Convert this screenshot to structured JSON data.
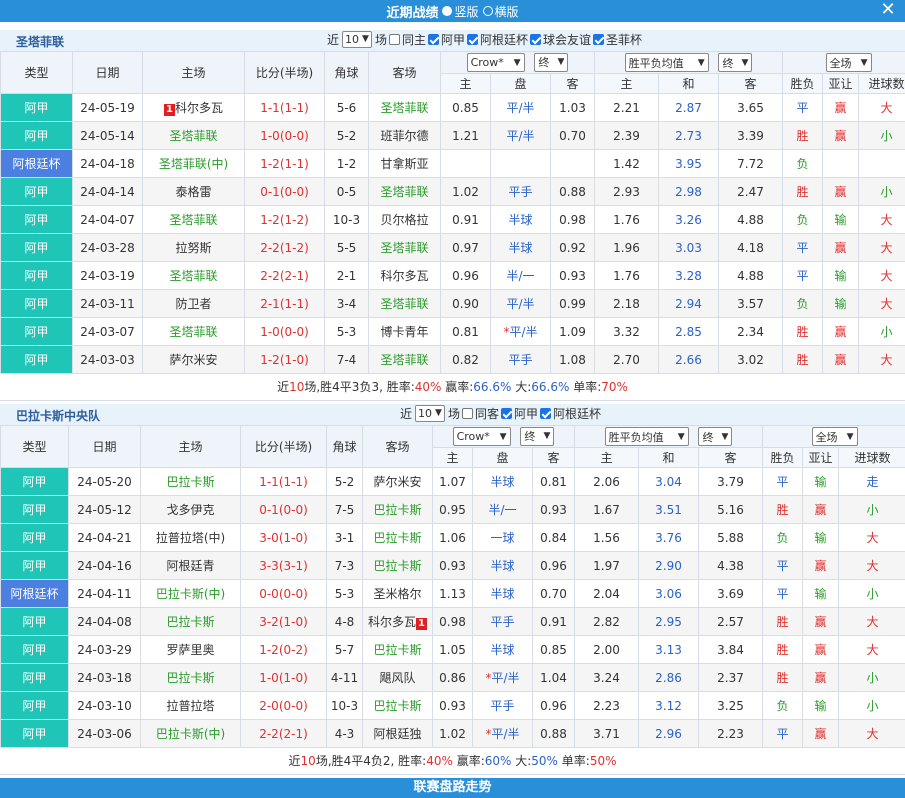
{
  "header": {
    "title": "近期战绩",
    "opt1": "竖版",
    "opt2": "横版"
  },
  "footer": {
    "title": "联赛盘路走势"
  },
  "columns": {
    "type": "类型",
    "date": "日期",
    "home": "主场",
    "score": "比分(半场)",
    "corner": "角球",
    "away": "客场",
    "win": "胜负",
    "handicap": "亚让",
    "goals": "进球数",
    "h": "主",
    "pan": "盘",
    "a": "客",
    "he": "和"
  },
  "odds_selects": {
    "company": "Crow*",
    "stage1": "终",
    "stage2": "终",
    "avg": "胜平负均值",
    "scope": "全场"
  },
  "s1": {
    "title": "圣塔菲联",
    "f": {
      "near": "近",
      "count": "10",
      "unit": "场",
      "same": "同主",
      "c1": "阿甲",
      "c2": "阿根廷杯",
      "c3": "球会友谊",
      "c4": "圣菲杯"
    },
    "rows": [
      {
        "t": "阿甲",
        "d": "24-05-19",
        "h": "科尔多瓦",
        "hrc": "1",
        "sc": "1-1(1-1)",
        "scc": "red",
        "cn": "5-6",
        "a": "圣塔菲联",
        "h1": "0.85",
        "pan": "平/半",
        "a1": "1.03",
        "w": "2.21",
        "dr": "2.87",
        "l": "3.65",
        "r": "平",
        "rc": "blue",
        "hc": "赢",
        "hcc": "red",
        "g": "大",
        "gc": "red"
      },
      {
        "t": "阿甲",
        "d": "24-05-14",
        "h": "圣塔菲联",
        "sc": "1-0(0-0)",
        "scc": "red",
        "cn": "5-2",
        "a": "班菲尔德",
        "h1": "1.21",
        "pan": "平/半",
        "a1": "0.70",
        "w": "2.39",
        "dr": "2.73",
        "l": "3.39",
        "r": "胜",
        "rc": "red",
        "hc": "赢",
        "hcc": "red",
        "g": "小",
        "gc": "green"
      },
      {
        "t": "阿根廷杯",
        "cup": true,
        "d": "24-04-18",
        "h": "圣塔菲联(中)",
        "sc": "1-2(1-1)",
        "scc": "red",
        "cn": "1-2",
        "a": "甘拿斯亚",
        "h1": "",
        "pan": "",
        "a1": "",
        "w": "1.42",
        "dr": "3.95",
        "l": "7.72",
        "r": "负",
        "rc": "green",
        "hc": "",
        "hcc": "",
        "g": "",
        "gc": ""
      },
      {
        "t": "阿甲",
        "d": "24-04-14",
        "h": "泰格雷",
        "sc": "0-1(0-0)",
        "scc": "red",
        "cn": "0-5",
        "a": "圣塔菲联",
        "h1": "1.02",
        "pan": "平手",
        "a1": "0.88",
        "w": "2.93",
        "dr": "2.98",
        "l": "2.47",
        "r": "胜",
        "rc": "red",
        "hc": "赢",
        "hcc": "red",
        "g": "小",
        "gc": "green"
      },
      {
        "t": "阿甲",
        "d": "24-04-07",
        "h": "圣塔菲联",
        "sc": "1-2(1-2)",
        "scc": "red",
        "cn": "10-3",
        "a": "贝尔格拉",
        "h1": "0.91",
        "pan": "半球",
        "a1": "0.98",
        "w": "1.76",
        "dr": "3.26",
        "l": "4.88",
        "r": "负",
        "rc": "green",
        "hc": "输",
        "hcc": "green",
        "g": "大",
        "gc": "red"
      },
      {
        "t": "阿甲",
        "d": "24-03-28",
        "h": "拉努斯",
        "sc": "2-2(1-2)",
        "scc": "red",
        "cn": "5-5",
        "a": "圣塔菲联",
        "h1": "0.97",
        "pan": "半球",
        "a1": "0.92",
        "w": "1.96",
        "dr": "3.03",
        "l": "4.18",
        "r": "平",
        "rc": "blue",
        "hc": "赢",
        "hcc": "red",
        "g": "大",
        "gc": "red"
      },
      {
        "t": "阿甲",
        "d": "24-03-19",
        "h": "圣塔菲联",
        "sc": "2-2(2-1)",
        "scc": "red",
        "cn": "2-1",
        "a": "科尔多瓦",
        "h1": "0.96",
        "pan": "半/一",
        "a1": "0.93",
        "w": "1.76",
        "dr": "3.28",
        "l": "4.88",
        "r": "平",
        "rc": "blue",
        "hc": "输",
        "hcc": "green",
        "g": "大",
        "gc": "red"
      },
      {
        "t": "阿甲",
        "d": "24-03-11",
        "h": "防卫者",
        "sc": "2-1(1-1)",
        "scc": "red",
        "cn": "3-4",
        "a": "圣塔菲联",
        "h1": "0.90",
        "pan": "平/半",
        "a1": "0.99",
        "w": "2.18",
        "dr": "2.94",
        "l": "3.57",
        "r": "负",
        "rc": "green",
        "hc": "输",
        "hcc": "green",
        "g": "大",
        "gc": "red"
      },
      {
        "t": "阿甲",
        "d": "24-03-07",
        "h": "圣塔菲联",
        "sc": "1-0(0-0)",
        "scc": "red",
        "cn": "5-3",
        "a": "博卡青年",
        "h1": "0.81",
        "pan": "*平/半",
        "panstar": true,
        "a1": "1.09",
        "w": "3.32",
        "dr": "2.85",
        "l": "2.34",
        "r": "胜",
        "rc": "red",
        "hc": "赢",
        "hcc": "red",
        "g": "小",
        "gc": "green"
      },
      {
        "t": "阿甲",
        "d": "24-03-03",
        "h": "萨尔米安",
        "sc": "1-2(1-0)",
        "scc": "red",
        "cn": "7-4",
        "a": "圣塔菲联",
        "h1": "0.82",
        "pan": "平手",
        "a1": "1.08",
        "w": "2.70",
        "dr": "2.66",
        "l": "3.02",
        "r": "胜",
        "rc": "red",
        "hc": "赢",
        "hcc": "red",
        "g": "大",
        "gc": "red"
      }
    ],
    "sum": {
      "a": "近",
      "n": "10",
      "b": "场,胜4平3负3, 胜率:",
      "wr": "40%",
      "c": " 赢率:",
      "yr": "66.6%",
      "d": " 大:",
      "dr": "66.6%",
      "e": " 单率:",
      "sr": "70%"
    }
  },
  "s2": {
    "title": "巴拉卡斯中央队",
    "f": {
      "near": "近",
      "count": "10",
      "unit": "场",
      "same": "同客",
      "c1": "阿甲",
      "c2": "阿根廷杯"
    },
    "rows": [
      {
        "t": "阿甲",
        "d": "24-05-20",
        "h": "巴拉卡斯",
        "sc": "1-1(1-1)",
        "scc": "red",
        "cn": "5-2",
        "a": "萨尔米安",
        "h1": "1.07",
        "pan": "半球",
        "a1": "0.81",
        "w": "2.06",
        "dr": "3.04",
        "l": "3.79",
        "r": "平",
        "rc": "blue",
        "hc": "输",
        "hcc": "green",
        "g": "走",
        "gc": "blue"
      },
      {
        "t": "阿甲",
        "d": "24-05-12",
        "h": "戈多伊克",
        "sc": "0-1(0-0)",
        "scc": "red",
        "cn": "7-5",
        "a": "巴拉卡斯",
        "h1": "0.95",
        "pan": "半/一",
        "a1": "0.93",
        "w": "1.67",
        "dr": "3.51",
        "l": "5.16",
        "r": "胜",
        "rc": "red",
        "hc": "赢",
        "hcc": "red",
        "g": "小",
        "gc": "green"
      },
      {
        "t": "阿甲",
        "d": "24-04-21",
        "h": "拉普拉塔(中)",
        "sc": "3-0(1-0)",
        "scc": "red",
        "cn": "3-1",
        "a": "巴拉卡斯",
        "h1": "1.06",
        "pan": "一球",
        "a1": "0.84",
        "w": "1.56",
        "dr": "3.76",
        "l": "5.88",
        "r": "负",
        "rc": "green",
        "hc": "输",
        "hcc": "green",
        "g": "大",
        "gc": "red"
      },
      {
        "t": "阿甲",
        "d": "24-04-16",
        "h": "阿根廷青",
        "sc": "3-3(3-1)",
        "scc": "red",
        "cn": "7-3",
        "a": "巴拉卡斯",
        "h1": "0.93",
        "pan": "半球",
        "a1": "0.96",
        "w": "1.97",
        "dr": "2.90",
        "l": "4.38",
        "r": "平",
        "rc": "blue",
        "hc": "赢",
        "hcc": "red",
        "g": "大",
        "gc": "red"
      },
      {
        "t": "阿根廷杯",
        "cup": true,
        "d": "24-04-11",
        "h": "巴拉卡斯(中)",
        "sc": "0-0(0-0)",
        "scc": "red",
        "cn": "5-3",
        "a": "圣米格尔",
        "h1": "1.13",
        "pan": "半球",
        "a1": "0.70",
        "w": "2.04",
        "dr": "3.06",
        "l": "3.69",
        "r": "平",
        "rc": "blue",
        "hc": "输",
        "hcc": "green",
        "g": "小",
        "gc": "green"
      },
      {
        "t": "阿甲",
        "d": "24-04-08",
        "h": "巴拉卡斯",
        "sc": "3-2(1-0)",
        "scc": "red",
        "cn": "4-8",
        "a": "科尔多瓦",
        "arc": "1",
        "h1": "0.98",
        "pan": "平手",
        "a1": "0.91",
        "w": "2.82",
        "dr": "2.95",
        "l": "2.57",
        "r": "胜",
        "rc": "red",
        "hc": "赢",
        "hcc": "red",
        "g": "大",
        "gc": "red"
      },
      {
        "t": "阿甲",
        "d": "24-03-29",
        "h": "罗萨里奥",
        "sc": "1-2(0-2)",
        "scc": "red",
        "cn": "5-7",
        "a": "巴拉卡斯",
        "h1": "1.05",
        "pan": "半球",
        "a1": "0.85",
        "w": "2.00",
        "dr": "3.13",
        "l": "3.84",
        "r": "胜",
        "rc": "red",
        "hc": "赢",
        "hcc": "red",
        "g": "大",
        "gc": "red"
      },
      {
        "t": "阿甲",
        "d": "24-03-18",
        "h": "巴拉卡斯",
        "sc": "1-0(1-0)",
        "scc": "red",
        "cn": "4-11",
        "a": "飓风队",
        "h1": "0.86",
        "pan": "*平/半",
        "panstar": true,
        "a1": "1.04",
        "w": "3.24",
        "dr": "2.86",
        "l": "2.37",
        "r": "胜",
        "rc": "red",
        "hc": "赢",
        "hcc": "red",
        "g": "小",
        "gc": "green"
      },
      {
        "t": "阿甲",
        "d": "24-03-10",
        "h": "拉普拉塔",
        "sc": "2-0(0-0)",
        "scc": "red",
        "cn": "10-3",
        "a": "巴拉卡斯",
        "h1": "0.93",
        "pan": "平手",
        "a1": "0.96",
        "w": "2.23",
        "dr": "3.12",
        "l": "3.25",
        "r": "负",
        "rc": "green",
        "hc": "输",
        "hcc": "green",
        "g": "小",
        "gc": "green"
      },
      {
        "t": "阿甲",
        "d": "24-03-06",
        "h": "巴拉卡斯(中)",
        "sc": "2-2(2-1)",
        "scc": "red",
        "cn": "4-3",
        "a": "阿根廷独",
        "h1": "1.02",
        "pan": "*平/半",
        "panstar": true,
        "a1": "0.88",
        "w": "3.71",
        "dr": "2.96",
        "l": "2.23",
        "r": "平",
        "rc": "blue",
        "hc": "赢",
        "hcc": "red",
        "g": "大",
        "gc": "red"
      }
    ],
    "sum": {
      "a": "近",
      "n": "10",
      "b": "场,胜4平4负2, 胜率:",
      "wr": "40%",
      "c": " 赢率:",
      "yr": "60%",
      "d": " 大:",
      "dr": "50%",
      "e": " 单率:",
      "sr": "50%"
    }
  }
}
